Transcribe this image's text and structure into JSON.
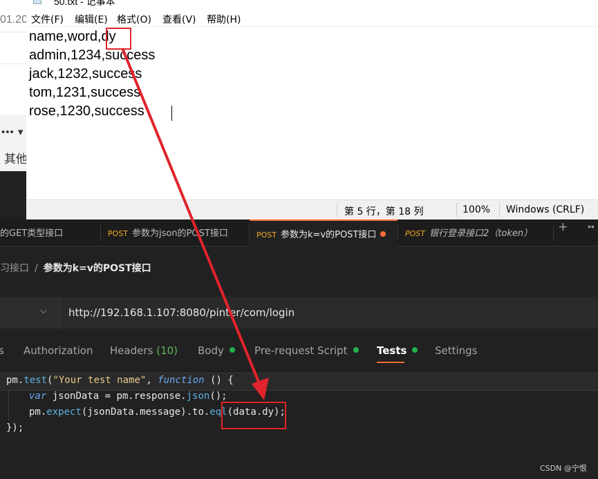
{
  "background_browser": {
    "date_fragment": "01.20",
    "more_dots": "••• ▾",
    "other_fragment": "其他"
  },
  "notepad": {
    "title": "50.txt - 记事本",
    "menu": [
      "文件(F)",
      "编辑(E)",
      "格式(O)",
      "查看(V)",
      "帮助(H)"
    ],
    "lines": [
      "name,word,dy",
      "admin,1234,success",
      "jack,1232,success",
      "tom,1231,success",
      "rose,1230,success"
    ],
    "status": {
      "position": "第 5 行，第 18 列",
      "zoom": "100%",
      "line_ending": "Windows (CRLF)"
    }
  },
  "postman": {
    "tabs": [
      {
        "method": "",
        "label": "的GET类型接口"
      },
      {
        "method": "POST",
        "label": "参数为json的POST接口"
      },
      {
        "method": "POST",
        "label": "参数为k=v的POST接口"
      },
      {
        "method": "POST",
        "label": "银行登录接口2（token）"
      }
    ],
    "tab_new": "+",
    "tab_more": "••",
    "breadcrumb": {
      "parent": "习接口",
      "separator": "/",
      "current": "参数为k=v的POST接口"
    },
    "method_chevron": "⌵",
    "url": "http://192.168.1.107:8080/pinter/com/login",
    "request_tabs": [
      {
        "label": "s"
      },
      {
        "label": "Authorization"
      },
      {
        "label": "Headers",
        "count": "(10)"
      },
      {
        "label": "Body"
      },
      {
        "label": "Pre-request Script"
      },
      {
        "label": "Tests"
      },
      {
        "label": "Settings"
      }
    ],
    "code": {
      "line1_obj": "pm.",
      "line1_fn": "test",
      "line1_open": "(",
      "line1_str": "\"Your test name\"",
      "line1_comma": ", ",
      "line1_kw": "function",
      "line1_rest": " () {",
      "line2_kw": "var",
      "line2_a": " jsonData = pm.response.",
      "line2_fn": "json",
      "line2_b": "();",
      "line3_a": "pm.",
      "line3_fn": "expect",
      "line3_b": "(jsonData.message).to.",
      "line3_fn2": "eql",
      "line3_c": "(data.dy);",
      "line4": "});"
    }
  },
  "annotation_color": "#e0242b",
  "watermark": "CSDN @宁恨"
}
